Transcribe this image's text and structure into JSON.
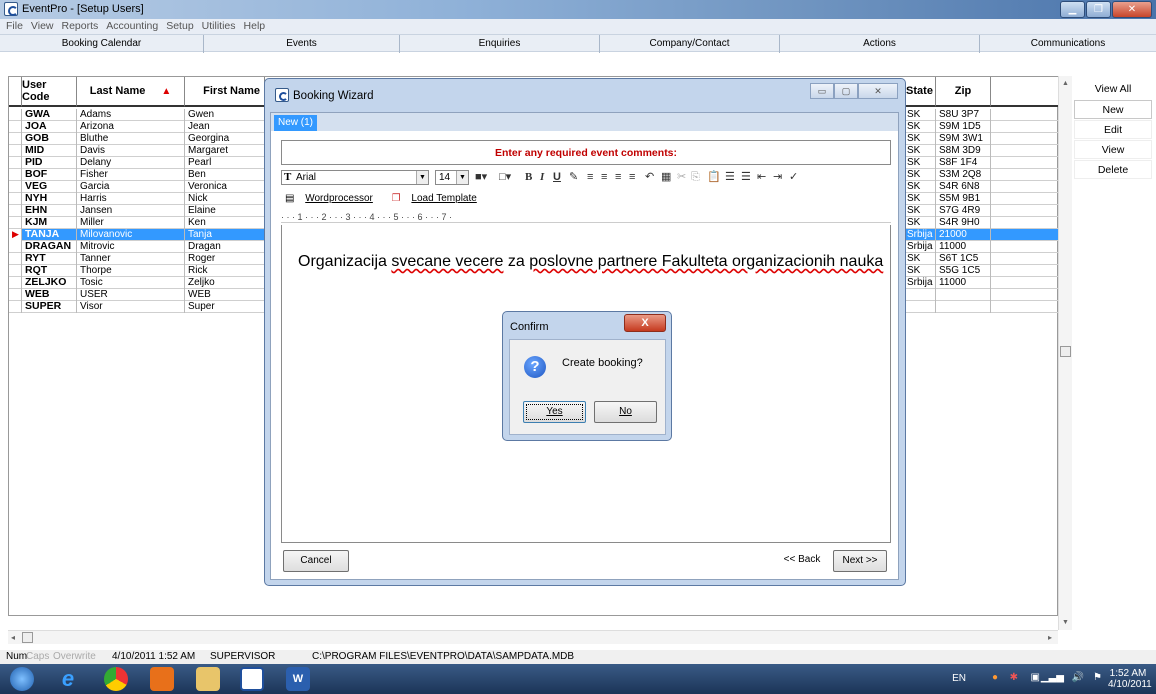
{
  "window": {
    "title": "EventPro - [Setup Users]"
  },
  "menu": [
    "File",
    "View",
    "Reports",
    "Accounting",
    "Setup",
    "Utilities",
    "Help"
  ],
  "nav": [
    "Booking Calendar",
    "Events",
    "Enquiries",
    "Company/Contact",
    "Actions",
    "Communications"
  ],
  "grid": {
    "headers": {
      "code": "User Code",
      "last": "Last Name",
      "first": "First Name",
      "state": "State",
      "zip": "Zip"
    },
    "rows": [
      {
        "code": "GWA",
        "last": "Adams",
        "first": "Gwen",
        "state": "SK",
        "zip": "S8U 3P7"
      },
      {
        "code": "JOA",
        "last": "Arizona",
        "first": "Jean",
        "state": "SK",
        "zip": "S9M 1D5"
      },
      {
        "code": "GOB",
        "last": "Bluthe",
        "first": "Georgina",
        "state": "SK",
        "zip": "S9M 3W1"
      },
      {
        "code": "MID",
        "last": "Davis",
        "first": "Margaret",
        "state": "SK",
        "zip": "S8M 3D9"
      },
      {
        "code": "PID",
        "last": "Delany",
        "first": "Pearl",
        "state": "SK",
        "zip": "S8F 1F4"
      },
      {
        "code": "BOF",
        "last": "Fisher",
        "first": "Ben",
        "state": "SK",
        "zip": "S3M 2Q8"
      },
      {
        "code": "VEG",
        "last": "Garcia",
        "first": "Veronica",
        "state": "SK",
        "zip": "S4R 6N8"
      },
      {
        "code": "NYH",
        "last": "Harris",
        "first": "Nick",
        "state": "SK",
        "zip": "S5M 9B1"
      },
      {
        "code": "EHN",
        "last": "Jansen",
        "first": "Elaine",
        "state": "SK",
        "zip": "S7G 4R9"
      },
      {
        "code": "KJM",
        "last": "Miller",
        "first": "Ken",
        "state": "SK",
        "zip": "S4R 9H0"
      },
      {
        "code": "TANJA",
        "last": "Milovanovic",
        "first": "Tanja",
        "state": "Srbija",
        "zip": "21000"
      },
      {
        "code": "DRAGAN",
        "last": "Mitrovic",
        "first": "Dragan",
        "state": "Srbija",
        "zip": "11000"
      },
      {
        "code": "RYT",
        "last": "Tanner",
        "first": "Roger",
        "state": "SK",
        "zip": "S6T 1C5"
      },
      {
        "code": "RQT",
        "last": "Thorpe",
        "first": "Rick",
        "state": "SK",
        "zip": "S5G 1C5"
      },
      {
        "code": "ZELJKO",
        "last": "Tosic",
        "first": "Zeljko",
        "state": "Srbija",
        "zip": "11000"
      },
      {
        "code": "WEB",
        "last": "USER",
        "first": "WEB",
        "state": "",
        "zip": ""
      },
      {
        "code": "SUPER",
        "last": "Visor",
        "first": "Super",
        "state": "",
        "zip": ""
      }
    ],
    "selected_row": "TANJA"
  },
  "actions": [
    "View All",
    "New",
    "Edit",
    "View",
    "Delete"
  ],
  "wizard": {
    "title": "Booking Wizard",
    "tab": "New (1)",
    "banner": "Enter any required event comments:",
    "font": "Arial",
    "font_size": "14",
    "wordprocessor": "Wordprocessor",
    "load_template": "Load Template",
    "ruler": "·  ·  ·  1  ·  ·  ·  2  ·  ·  ·  3  ·  ·  ·  4  ·  ·  ·  5  ·  ·  ·  6  ·  ·  ·  7  ·",
    "text_pre": "Organizacija ",
    "text_sp1": "svecane vecere",
    "text_mid": " za ",
    "text_sp2": "poslovne partnere Fakulteta organizacionih nauka",
    "cancel": "Cancel",
    "back": "<< Back",
    "next": "Next >>"
  },
  "confirm": {
    "title": "Confirm",
    "close": "X",
    "message": "Create booking?",
    "yes": "Yes",
    "no": "No"
  },
  "status": {
    "num": "Num",
    "caps": "Caps",
    "overwrite": "Overwrite",
    "datetime": "4/10/2011 1:52 AM",
    "user": "SUPERVISOR",
    "path": "C:\\PROGRAM FILES\\EVENTPRO\\DATA\\SAMPDATA.MDB"
  },
  "tray": {
    "lang": "EN",
    "time": "1:52 AM",
    "date": "4/10/2011"
  }
}
